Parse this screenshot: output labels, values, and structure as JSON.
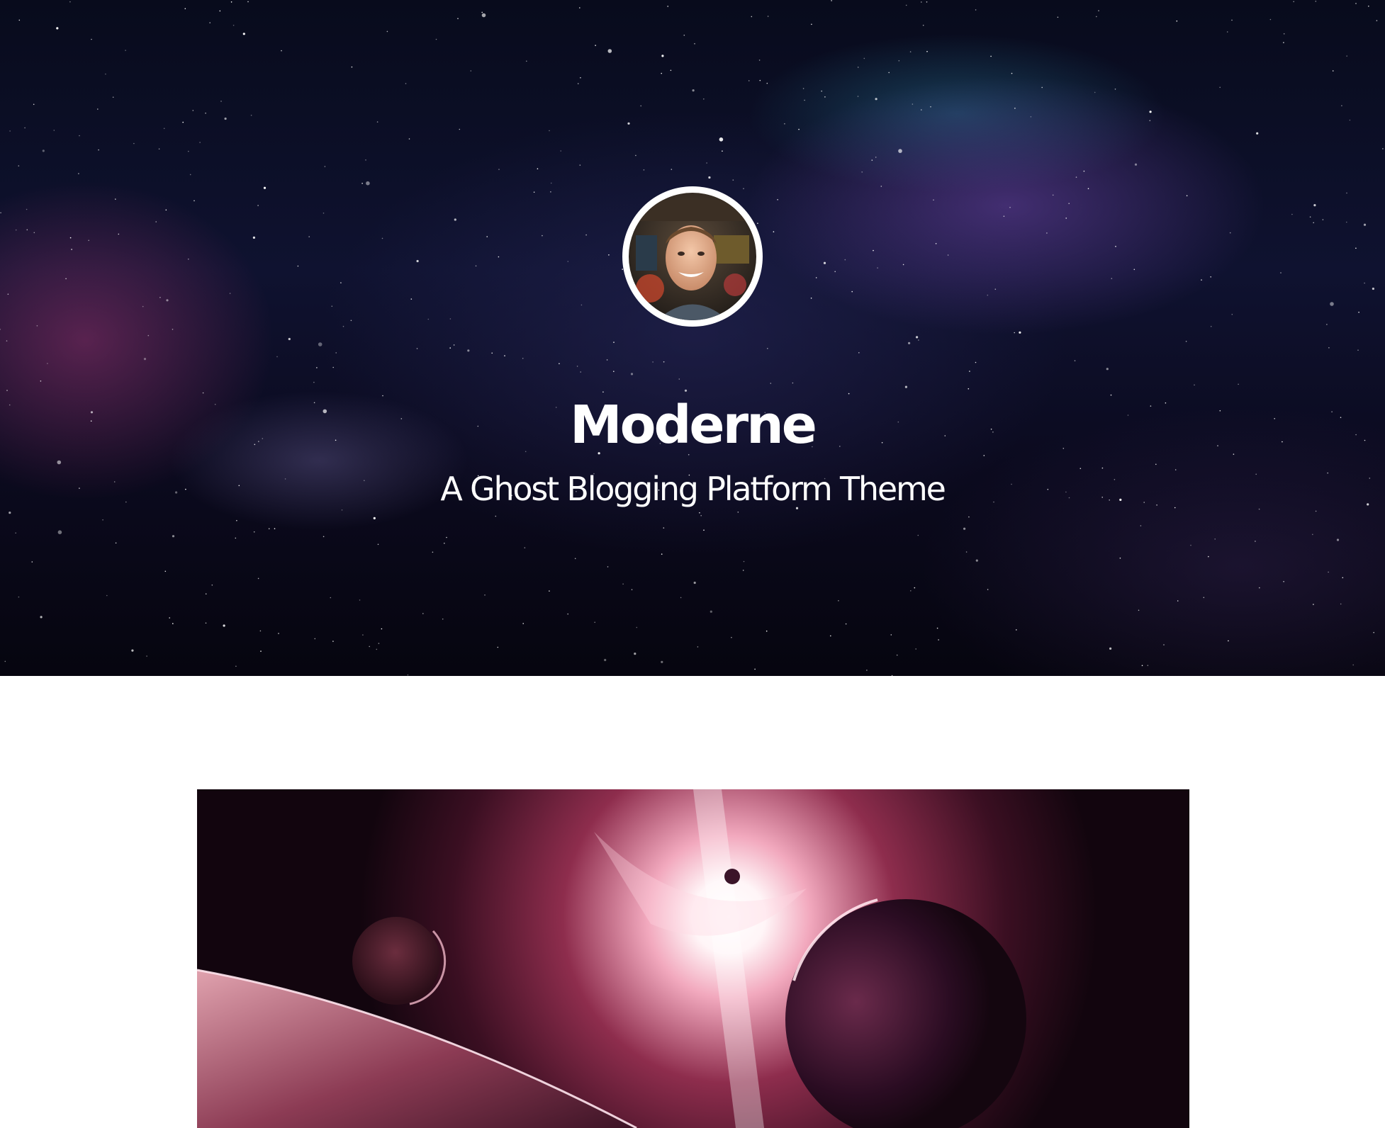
{
  "site": {
    "title": "Moderne",
    "description": "A Ghost Blogging Platform Theme"
  },
  "hero": {
    "background": "space-nebula-image",
    "avatar": "author-portrait-photo"
  },
  "feed": {
    "first_post_image": "planet-explosion-image"
  },
  "colors": {
    "hero_text": "#ffffff",
    "page_background": "#ffffff",
    "hero_base": "#0b0d24",
    "post_image_tone": "#a8405e"
  }
}
